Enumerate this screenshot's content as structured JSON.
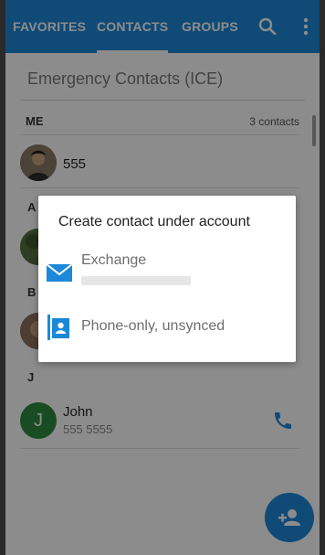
{
  "tabs": {
    "favorites": "FAVORITES",
    "contacts": "CONTACTS",
    "groups": "GROUPS"
  },
  "toolbar_icons": [
    "search-icon",
    "more-vert-icon"
  ],
  "ice_label": "Emergency Contacts (ICE)",
  "me_section": {
    "label": "ME",
    "count": "3 contacts",
    "name": "555"
  },
  "sections": [
    "A",
    "B",
    "J"
  ],
  "contact": {
    "initial": "J",
    "name": "John",
    "phone": "555 5555"
  },
  "dialog": {
    "title": "Create contact under account",
    "options": [
      {
        "label": "Exchange",
        "icon": "email-icon"
      },
      {
        "label": "Phone-only, unsynced",
        "icon": "contact-card-icon"
      }
    ]
  },
  "colors": {
    "accent": "#1e88d8",
    "avatar_green": "#2e8b3e"
  }
}
